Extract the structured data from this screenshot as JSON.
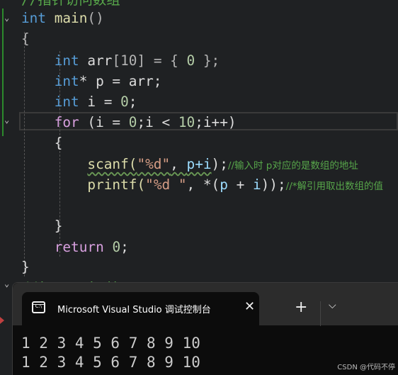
{
  "editor": {
    "lines": [
      [
        [
          "//指针访问数组",
          "cm"
        ]
      ],
      [
        [
          "int",
          "kw"
        ],
        [
          " main",
          "fn"
        ],
        [
          "()",
          "op"
        ]
      ],
      [
        [
          "{",
          "op"
        ]
      ],
      [
        [
          "    ",
          ""
        ],
        [
          "int",
          "kw"
        ],
        [
          " arr",
          ""
        ],
        [
          "[10]",
          "op"
        ],
        [
          " = { ",
          "op"
        ],
        [
          "0",
          "num"
        ],
        [
          " };",
          "op"
        ]
      ],
      [
        [
          "    ",
          ""
        ],
        [
          "int",
          "kw"
        ],
        [
          "* p = arr;",
          ""
        ]
      ],
      [
        [
          "    ",
          ""
        ],
        [
          "int",
          "kw"
        ],
        [
          " i = ",
          ""
        ],
        [
          "0",
          "num"
        ],
        [
          ";",
          ""
        ]
      ],
      [
        [
          "    ",
          ""
        ],
        [
          "for",
          "ctl"
        ],
        [
          " (i = ",
          ""
        ],
        [
          "0",
          "num"
        ],
        [
          ";i < ",
          ""
        ],
        [
          "10",
          "num"
        ],
        [
          ";i++)",
          ""
        ]
      ],
      [
        [
          "    {",
          ""
        ]
      ],
      [
        [
          "        ",
          ""
        ],
        [
          "scanf(",
          "fn squig"
        ],
        [
          "\"%d\"",
          "str squig"
        ],
        [
          ", ",
          "squig"
        ],
        [
          "p+i",
          "var squig"
        ],
        [
          ")",
          ""
        ],
        [
          ";",
          ""
        ],
        [
          "//输入时 p对应的是数组的地址",
          "cm"
        ]
      ],
      [
        [
          "        ",
          ""
        ],
        [
          "printf(",
          "fn"
        ],
        [
          "\"%d \"",
          "str"
        ],
        [
          ", *(",
          ""
        ],
        [
          "p",
          "var"
        ],
        [
          " + ",
          ""
        ],
        [
          "i",
          "var"
        ],
        [
          "));",
          ""
        ],
        [
          "//*解引用取出数组的值",
          "cm"
        ]
      ],
      [
        [
          "",
          ""
        ]
      ],
      [
        [
          "    }",
          ""
        ]
      ],
      [
        [
          "    ",
          ""
        ],
        [
          "return",
          "ctl"
        ],
        [
          " ",
          ""
        ],
        [
          "0",
          "num"
        ],
        [
          ";",
          ""
        ]
      ],
      [
        [
          "}",
          ""
        ]
      ],
      [
        [
          "//int main()",
          "cm"
        ]
      ]
    ]
  },
  "terminal": {
    "tab_title": "Microsoft Visual Studio 调试控制台",
    "tab_icon_text": "C:\\",
    "close_icon": "close-icon",
    "new_tab_label": "+",
    "dropdown_icon": "chevron-down-icon",
    "output": [
      "1 2 3 4 5 6 7 8 9 10",
      "1 2 3 4 5 6 7 8 9 10"
    ]
  },
  "watermark": "CSDN @代码不停"
}
